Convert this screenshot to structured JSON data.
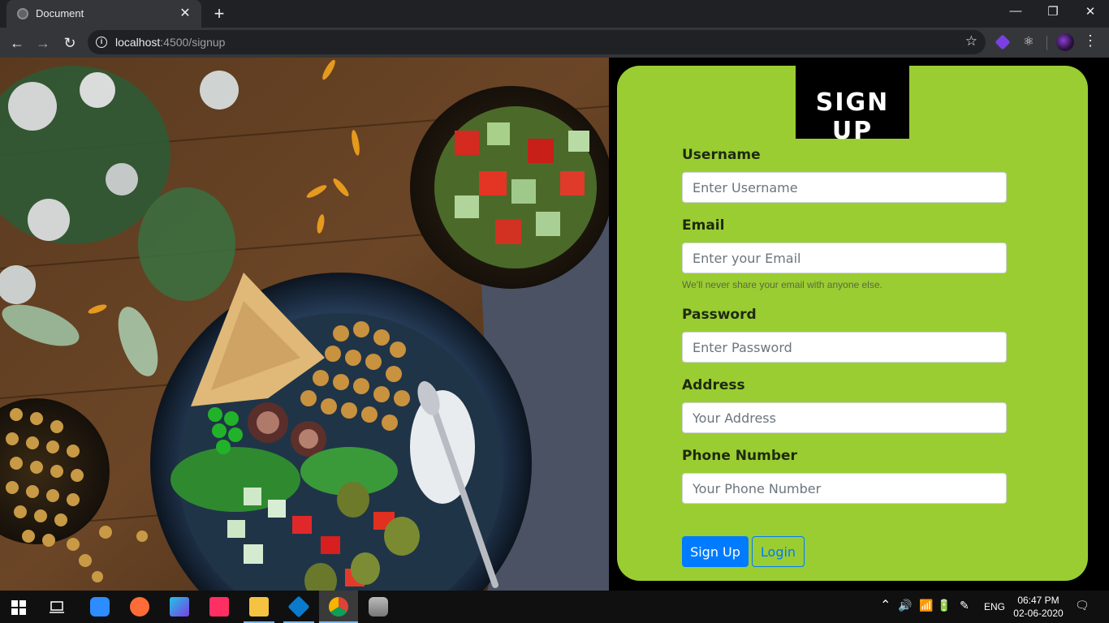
{
  "browser": {
    "tab_title": "Document",
    "url_host": "localhost",
    "url_rest": ":4500/signup"
  },
  "form": {
    "heading": "SIGN UP",
    "fields": [
      {
        "label": "Username",
        "placeholder": "Enter Username",
        "value": ""
      },
      {
        "label": "Email",
        "placeholder": "Enter your Email",
        "value": "",
        "help": "We'll never share your email with anyone else."
      },
      {
        "label": "Password",
        "placeholder": "Enter Password",
        "value": ""
      },
      {
        "label": "Address",
        "placeholder": "Your Address",
        "value": ""
      },
      {
        "label": "Phone Number",
        "placeholder": "Your Phone Number",
        "value": ""
      }
    ],
    "submit_label": "Sign Up",
    "login_label": "Login"
  },
  "colors": {
    "card": "#9acd32",
    "heading_bg": "#000000",
    "primary": "#007bff"
  },
  "taskbar": {
    "apps": [
      "start-icon",
      "task-view-icon",
      "zoom-icon",
      "postman-icon",
      "app-icon",
      "app-icon",
      "file-explorer-icon",
      "vscode-icon",
      "chrome-icon",
      "database-icon"
    ],
    "language": "ENG",
    "time": "06:47 PM",
    "date": "02-06-2020"
  }
}
